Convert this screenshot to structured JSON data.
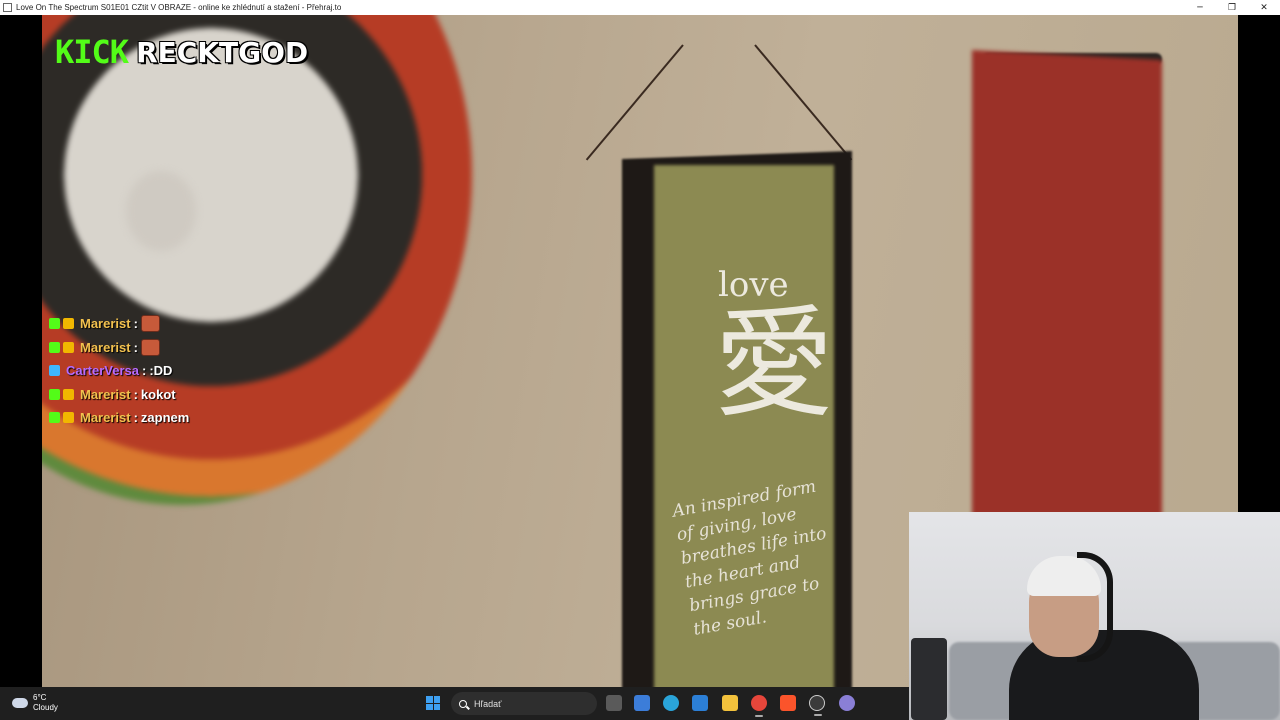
{
  "window": {
    "title": "Love On The Spectrum S01E01 CZtit V OBRAZE - online ke zhlédnutí a stažení - Přehraj.to",
    "controls": {
      "minimize": "─",
      "restore": "❐",
      "close": "✕"
    }
  },
  "stream_overlay": {
    "platform_logo": "KICK",
    "channel_name": "RECKTGOD",
    "accent_color": "#53fc18"
  },
  "chat": {
    "messages": [
      {
        "user": "Marerist",
        "separator": ":",
        "text": "",
        "emote": true,
        "user_color": "#f2c14e",
        "badges": [
          "sub",
          "crown"
        ]
      },
      {
        "user": "Marerist",
        "separator": ":",
        "text": "",
        "emote": true,
        "user_color": "#f2c14e",
        "badges": [
          "sub",
          "crown"
        ]
      },
      {
        "user": "CarterVersa",
        "separator": ":",
        "text": ":DD",
        "emote": false,
        "user_color": "#b56bff",
        "badges": [
          "blue"
        ]
      },
      {
        "user": "Marerist",
        "separator": ":",
        "text": "kokot",
        "emote": false,
        "user_color": "#f2c14e",
        "badges": [
          "sub",
          "crown"
        ]
      },
      {
        "user": "Marerist",
        "separator": ":",
        "text": "zapnem",
        "emote": false,
        "user_color": "#f2c14e",
        "badges": [
          "sub",
          "crown"
        ]
      }
    ]
  },
  "video_scene": {
    "banner_word": "love",
    "banner_kanji": "愛",
    "banner_quote": "An inspired form of giving, love breathes life into the heart and brings grace to the soul."
  },
  "taskbar": {
    "weather": {
      "temperature": "6°C",
      "condition": "Cloudy",
      "icon": "cloud-icon"
    },
    "search_placeholder": "Hľadať",
    "pinned_apps": [
      {
        "name": "task-view-icon",
        "color": "#5a5a5a"
      },
      {
        "name": "store-icon",
        "color": "#3c7dd9"
      },
      {
        "name": "edge-icon",
        "color": "#2aa4d9"
      },
      {
        "name": "photos-icon",
        "color": "#2c7fd6"
      },
      {
        "name": "file-explorer-icon",
        "color": "#f3c23c"
      },
      {
        "name": "chrome-icon",
        "color": "#e7463b"
      },
      {
        "name": "brave-icon",
        "color": "#fb542b"
      },
      {
        "name": "obs-icon",
        "color": "#3b3b3b"
      },
      {
        "name": "app-icon",
        "color": "#8a7fd6"
      }
    ]
  }
}
